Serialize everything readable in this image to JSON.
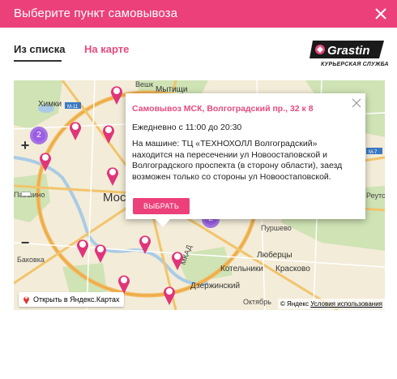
{
  "dialog": {
    "title": "Выберите пункт самовывоза",
    "close_icon": "close-icon"
  },
  "tabs": [
    {
      "label": "Из списка",
      "active": true
    },
    {
      "label": "На карте",
      "active": false
    }
  ],
  "logo": {
    "brand": "Grastin",
    "subtitle": "КУРЬЕРСКАЯ СЛУЖБА"
  },
  "map": {
    "labels": {
      "khimki": "Химки",
      "mytishchi": "Мытищи",
      "vesh": "Вешк",
      "moscow": "Мос",
      "reutov": "Реутов",
      "lyubertsy": "Люберцы",
      "kotelniki": "Котельники",
      "kraskovo": "Красково",
      "dzerzhinsky": "Дзержинский",
      "pavshino": "Павшино",
      "bakovka": "Баковка",
      "mkad": "МКАД",
      "oktyabrsky": "Октябрь",
      "purshevo": "Пуршево",
      "m11": "М-11",
      "m7": "М-7"
    },
    "clusters": [
      "2",
      "2"
    ],
    "open_yandex_label": "Открыть в Яндекс.Картах",
    "copyright": "© Яндекс",
    "terms_link": "Условия использования",
    "zoom_in": "+",
    "zoom_out": "−"
  },
  "balloon": {
    "title": "Самовывоз МСК, Волгоградский пр., 32 к 8",
    "hours": "Ежедневно с 11:00 до 20:30",
    "description": "На машине: ТЦ «ТЕХНОХОЛЛ Волгоградский» находится на пересечении ул Новоостаповской и Волгоградского проспекта (в сторону области), заезд возможен только со стороны ул Новоостаповской. Пешком: Первый вагон из центра, из стеклянных дверей налево. Сразу сп",
    "select_label": "ВЫБРАТЬ"
  },
  "colors": {
    "accent": "#ec407a",
    "link": "#e64a7e",
    "marker": "#e0357a",
    "cluster": "#9b5de5"
  }
}
